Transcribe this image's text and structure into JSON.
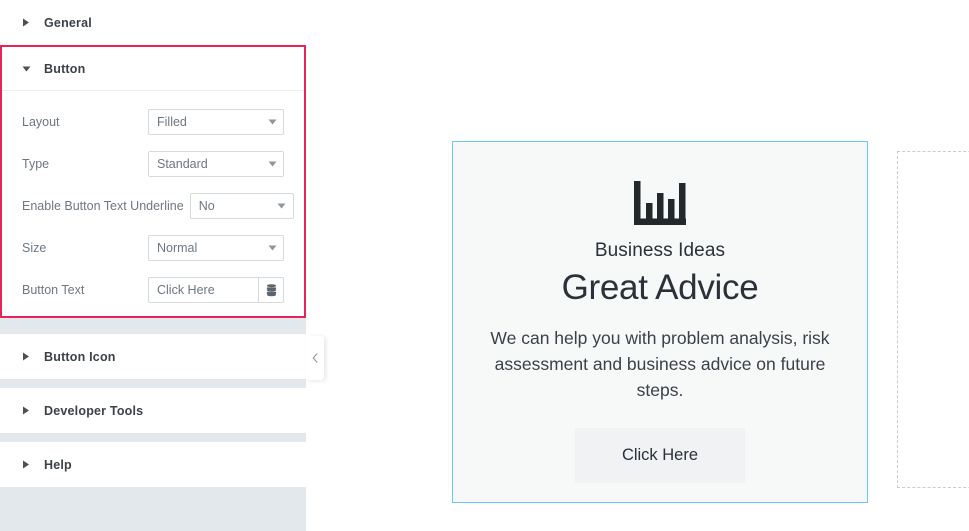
{
  "sidebar": {
    "sections": [
      {
        "id": "general",
        "label": "General",
        "expanded": false
      },
      {
        "id": "button",
        "label": "Button",
        "expanded": true
      },
      {
        "id": "button-icon",
        "label": "Button Icon",
        "expanded": false
      },
      {
        "id": "developer-tools",
        "label": "Developer Tools",
        "expanded": false
      },
      {
        "id": "help",
        "label": "Help",
        "expanded": false
      }
    ],
    "button_section": {
      "title": "Button",
      "highlight_color": "#e8235a",
      "controls": [
        {
          "label": "Layout",
          "value": "Filled",
          "type": "select"
        },
        {
          "label": "Type",
          "value": "Standard",
          "type": "select"
        },
        {
          "label": "Enable Button Text Underline",
          "value": "No",
          "type": "select"
        },
        {
          "label": "Size",
          "value": "Normal",
          "type": "select"
        },
        {
          "label": "Button Text",
          "value": "Click Here",
          "placeholder": "Click Here",
          "type": "text",
          "addon_icon": "database-stack-icon"
        }
      ]
    },
    "collapse_handle": {
      "icon": "chevron-left-icon"
    }
  },
  "canvas": {
    "card": {
      "icon": "bar-chart-icon",
      "eyebrow": "Business Ideas",
      "headline": "Great Advice",
      "body": "We can help you with problem analysis, risk assessment and business advice on future steps.",
      "cta_label": "Click Here",
      "border_color": "#6ec8f2",
      "background_color": "#f7f8f8"
    },
    "drop_zone": {
      "border_style": "dashed",
      "border_color": "#c9ced3"
    }
  }
}
